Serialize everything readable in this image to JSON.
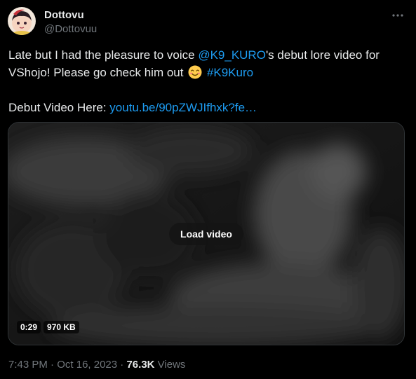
{
  "author": {
    "display_name": "Dottovu",
    "handle": "@Dottovuu"
  },
  "tweet": {
    "text_1": "Late but I had the pleasure to voice ",
    "mention": "@K9_KURO",
    "text_2": "'s debut lore video for VShojo! Please go check him out ",
    "emoji": "smiling-face-icon",
    "hashtag": "#K9Kuro",
    "link_prefix": "Debut Video Here: ",
    "link_text": "youtu.be/90pZWJIfhxk?fe…"
  },
  "media": {
    "load_button": "Load video",
    "duration": "0:29",
    "size": "970 KB"
  },
  "meta": {
    "time": "7:43 PM",
    "separator": "·",
    "date": "Oct 16, 2023",
    "views_count": "76.3K",
    "views_label": "Views"
  },
  "colors": {
    "background": "#000000",
    "text": "#e7e9ea",
    "secondary": "#71767b",
    "link": "#1d9bf0",
    "border": "#2f3336"
  }
}
